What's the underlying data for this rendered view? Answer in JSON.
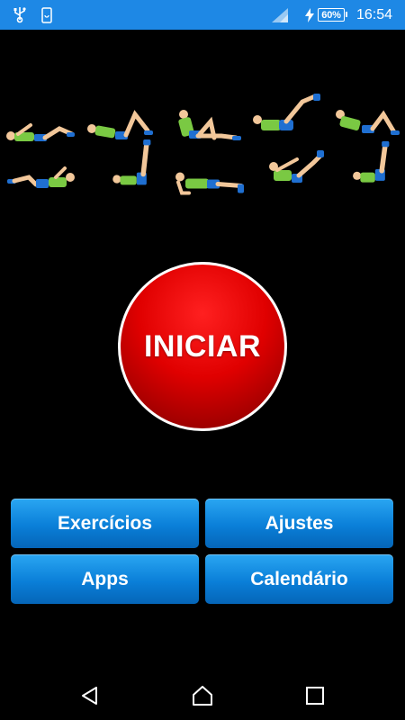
{
  "status_bar": {
    "battery": "60%",
    "time": "16:54",
    "icons": [
      "usb-icon",
      "screenshot-notification-icon",
      "cellular-signal-icon",
      "charging-icon",
      "battery-icon"
    ]
  },
  "exercise_images": [
    "crunch-figure",
    "knee-crunch-figure",
    "bicycle-crunch-figure",
    "v-up-figure",
    "twist-crunch-figure",
    "side-crunch-figure",
    "leg-raise-figure",
    "plank-figure",
    "heel-touch-figure",
    "vertical-crunch-figure"
  ],
  "main": {
    "start_label": "INICIAR",
    "start_color": "#d80000"
  },
  "menu": {
    "exercises_label": "Exercícios",
    "settings_label": "Ajustes",
    "apps_label": "Apps",
    "calendar_label": "Calendário",
    "button_color": "#0a7fd8"
  },
  "nav_bar": {
    "icons": [
      "back-icon",
      "home-icon",
      "recents-icon"
    ]
  }
}
